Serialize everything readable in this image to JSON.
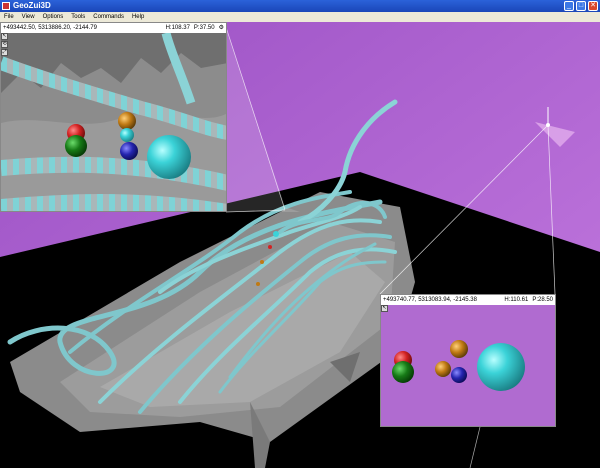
{
  "window": {
    "title": "GeoZui3D"
  },
  "menu": [
    "File",
    "View",
    "Options",
    "Tools",
    "Commands",
    "Help"
  ],
  "inset_top_left": {
    "coords": "+493442.50, 5313886.20, -2144.79",
    "heading": "H:108.37",
    "pitch": "P:37.50"
  },
  "inset_bottom_right": {
    "coords": "+493740.77, 5313083.94, -2145.38",
    "heading": "H:110.61",
    "pitch": "P:28.50"
  },
  "colors": {
    "sky": "#b56ad6",
    "terrain": "#8d8d8d",
    "tube": "#82d4d8",
    "sphere_cyan": "#3bd3d8"
  }
}
